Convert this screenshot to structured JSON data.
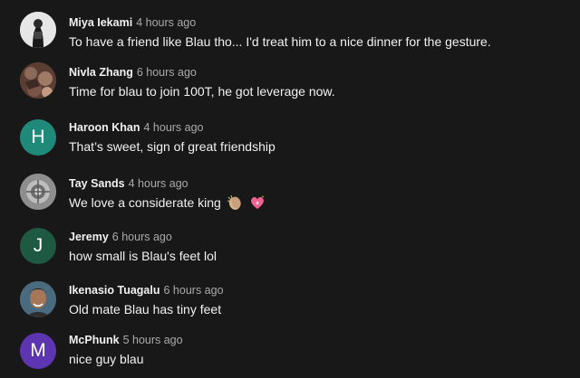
{
  "comments": [
    {
      "author": "Miya Iekami",
      "time": "4 hours ago",
      "text": "To have a friend like Blau tho... I'd treat him to a nice dinner for the gesture.",
      "avatar_type": "photo",
      "avatar_color": "#e9e9e9"
    },
    {
      "author": "Nivla Zhang",
      "time": "6 hours ago",
      "text": "Time for blau to join 100T, he got leverage now.",
      "avatar_type": "photo",
      "avatar_color": "#6b4a3c"
    },
    {
      "author": "Haroon Khan",
      "time": "4 hours ago",
      "text": "That’s sweet, sign of great friendship",
      "avatar_type": "letter",
      "avatar_letter": "H",
      "avatar_color": "#1f8a7a"
    },
    {
      "author": "Tay Sands",
      "time": "4 hours ago",
      "text": "We love a considerate king",
      "avatar_type": "photo",
      "avatar_color": "#9a9a9a",
      "emojis": [
        "clapping-hands-emoji",
        "sparkling-heart-emoji"
      ]
    },
    {
      "author": "Jeremy",
      "time": "6 hours ago",
      "text": "how small is Blau's feet lol",
      "avatar_type": "letter",
      "avatar_letter": "J",
      "avatar_color": "#1e5944"
    },
    {
      "author": "Ikenasio Tuagalu",
      "time": "6 hours ago",
      "text": "Old mate Blau has tiny feet",
      "avatar_type": "photo",
      "avatar_color": "#7b5a4a"
    },
    {
      "author": "McPhunk",
      "time": "5 hours ago",
      "text": "nice guy blau",
      "avatar_type": "letter",
      "avatar_letter": "M",
      "avatar_color": "#5e35b1"
    }
  ]
}
